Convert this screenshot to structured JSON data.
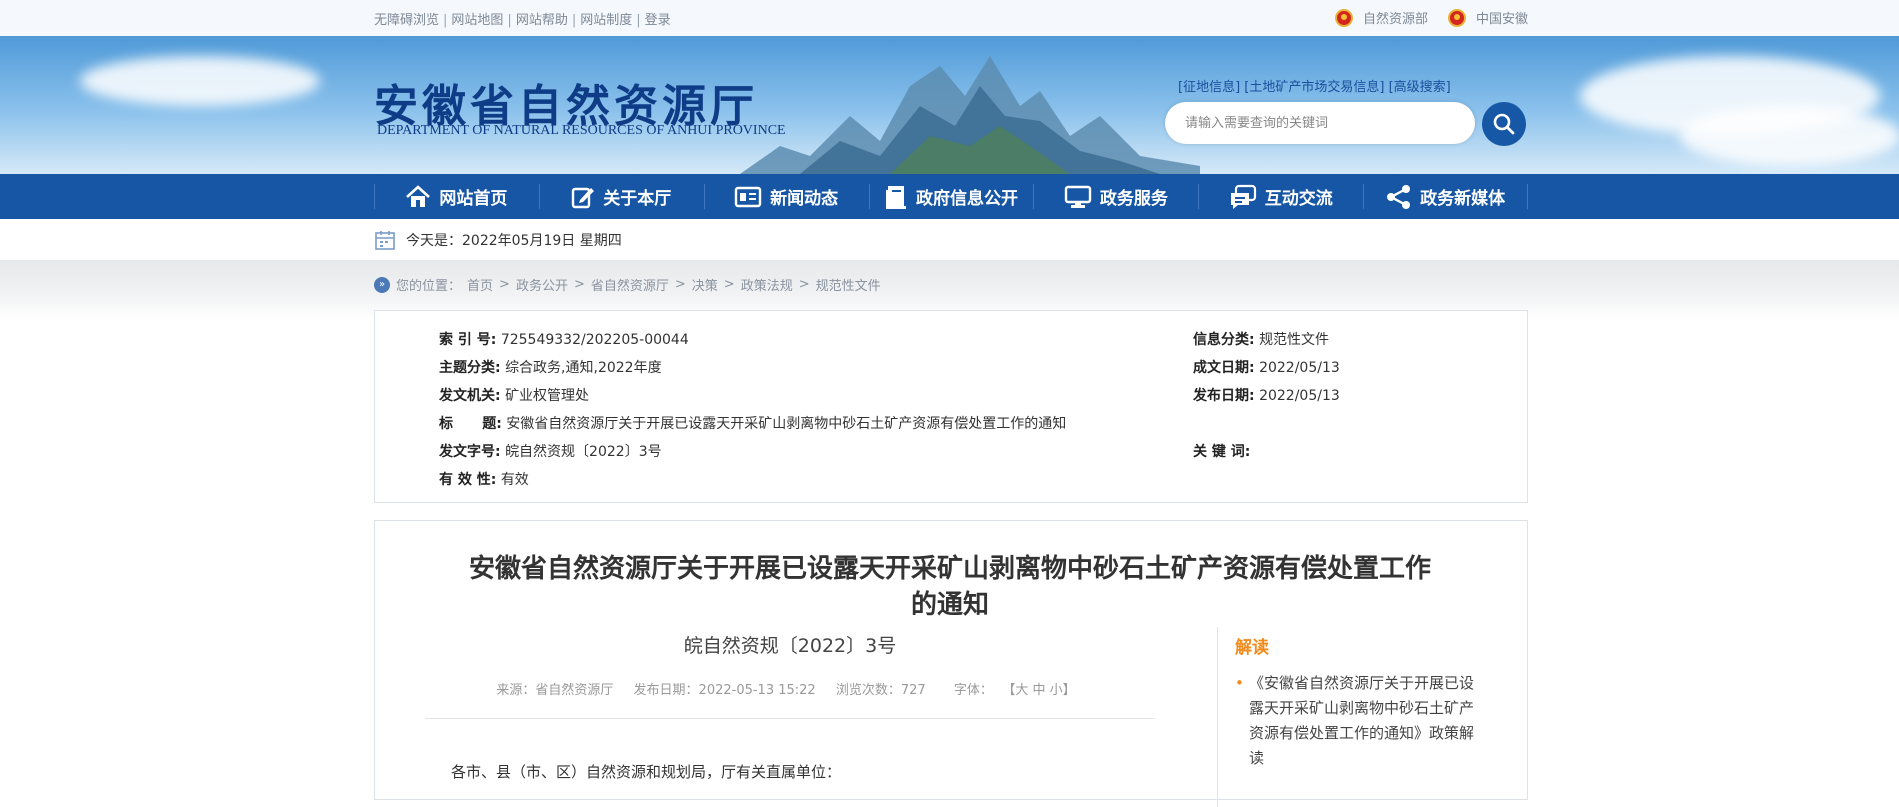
{
  "top": {
    "links": [
      "无障碍浏览",
      "网站地图",
      "网站帮助",
      "网站制度",
      "登录"
    ],
    "right": [
      "自然资源部",
      "中国安徽"
    ]
  },
  "banner": {
    "title": "安徽省自然资源厅",
    "subtitle": "DEPARTMENT OF NATURAL RESOURCES OF ANHUI PROVINCE",
    "quicklinks": [
      "[征地信息]",
      "[土地矿产市场交易信息]",
      "[高级搜索]"
    ],
    "search_placeholder": "请输入需要查询的关键词"
  },
  "nav": [
    {
      "label": "网站首页",
      "icon": "home-icon"
    },
    {
      "label": "关于本厅",
      "icon": "edit-icon"
    },
    {
      "label": "新闻动态",
      "icon": "news-icon"
    },
    {
      "label": "政府信息公开",
      "icon": "book-icon"
    },
    {
      "label": "政务服务",
      "icon": "monitor-icon"
    },
    {
      "label": "互动交流",
      "icon": "chat-icon"
    },
    {
      "label": "政务新媒体",
      "icon": "share-icon"
    }
  ],
  "date": {
    "text": "今天是：2022年05月19日 星期四"
  },
  "breadcrumb": {
    "prefix": "您的位置：",
    "items": [
      "首页",
      "政务公开",
      "省自然资源厅",
      "决策",
      "政策法规",
      "规范性文件"
    ]
  },
  "meta": {
    "left": [
      {
        "label": "索  引  号:",
        "value": "725549332/202205-00044"
      },
      {
        "label": "主题分类:",
        "value": "综合政务,通知,2022年度"
      },
      {
        "label": "发文机关:",
        "value": "矿业权管理处"
      },
      {
        "label": "标      题:",
        "value": "安徽省自然资源厅关于开展已设露天开采矿山剥离物中砂石土矿产资源有偿处置工作的通知"
      },
      {
        "label": "发文字号:",
        "value": "皖自然资规〔2022〕3号"
      },
      {
        "label": "有  效  性:",
        "value": "有效"
      }
    ],
    "right": [
      {
        "label": "信息分类:",
        "value": "规范性文件"
      },
      {
        "label": "成文日期:",
        "value": "2022/05/13"
      },
      {
        "label": "发布日期:",
        "value": "2022/05/13"
      },
      {
        "label": "",
        "value": ""
      },
      {
        "label": "关  键  词:",
        "value": ""
      }
    ]
  },
  "article": {
    "title_line1": "安徽省自然资源厅关于开展已设露天开采矿山剥离物中砂石土矿产资源有偿处置工作",
    "title_line2": "的通知",
    "doc_no": "皖自然资规〔2022〕3号",
    "source": "来源：省自然资源厅",
    "date": "发布日期：2022-05-13 15:22",
    "views": "浏览次数：727",
    "font_label": "字体：",
    "font_sizes": "【大 中 小】",
    "body_first": "各市、县（市、区）自然资源和规划局，厅有关直属单位："
  },
  "sidebar": {
    "heading": "解读",
    "item": "《安徽省自然资源厅关于开展已设露天开采矿山剥离物中砂石土矿产资源有偿处置工作的通知》政策解读"
  },
  "colors": {
    "nav": "#1656a5",
    "title_blue": "#0f3c86",
    "accent": "#f08b1c"
  }
}
